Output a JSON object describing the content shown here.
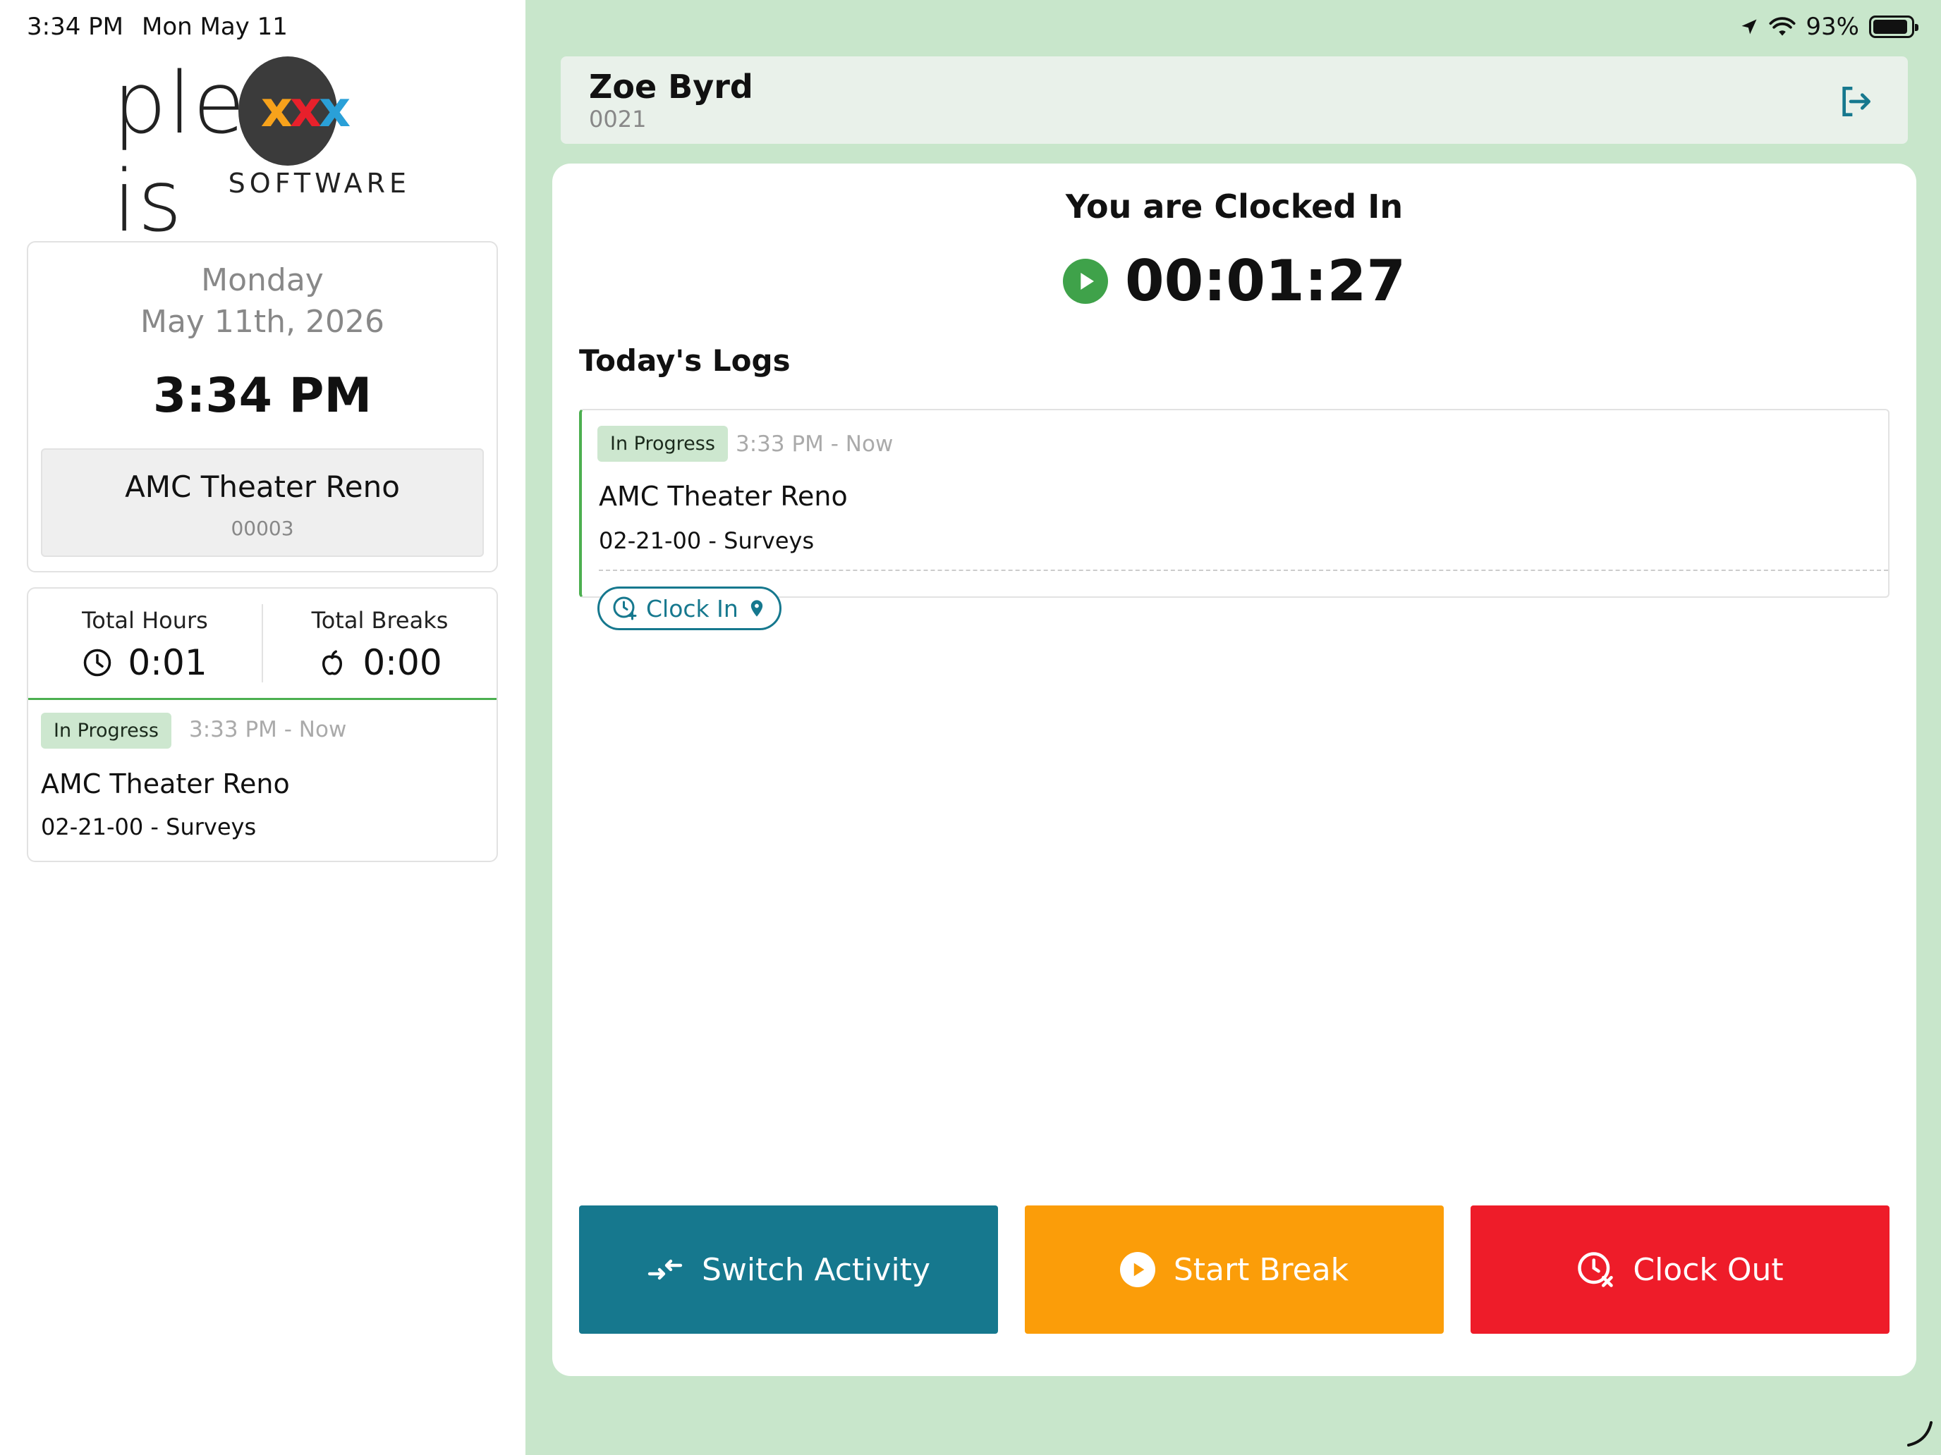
{
  "status_bar": {
    "time": "3:34 PM",
    "date": "Mon May 11",
    "battery": "93%",
    "battery_level": 0.93
  },
  "logo": {
    "word_left": "ple",
    "word_middle": "xxx",
    "word_right": "is",
    "subtitle": "SOFTWARE"
  },
  "date_card": {
    "day": "Monday",
    "date": "May 11th, 2026",
    "time": "3:34 PM",
    "job_name": "AMC Theater Reno",
    "job_code": "00003"
  },
  "totals": {
    "hours_label": "Total Hours",
    "hours_value": "0:01",
    "breaks_label": "Total Breaks",
    "breaks_value": "0:00"
  },
  "sidebar_log": {
    "status": "In Progress",
    "time_range": "3:33 PM - Now",
    "job": "AMC Theater Reno",
    "task": "02-21-00 - Surveys"
  },
  "user": {
    "name": "Zoe Byrd",
    "id": "0021"
  },
  "main": {
    "title": "You are Clocked In",
    "timer": "00:01:27",
    "logs_title": "Today's Logs",
    "log": {
      "status": "In Progress",
      "time_range": "3:33 PM - Now",
      "job": "AMC Theater Reno",
      "task": "02-21-00 - Surveys",
      "clock_in_label": "Clock In"
    }
  },
  "actions": {
    "switch_label": "Switch Activity",
    "break_label": "Start Break",
    "clockout_label": "Clock Out"
  },
  "colors": {
    "teal": "#16788e",
    "orange": "#fb9d09",
    "red": "#ee1c29",
    "green": "#4caf50",
    "panel_bg": "#c8e6cb"
  }
}
